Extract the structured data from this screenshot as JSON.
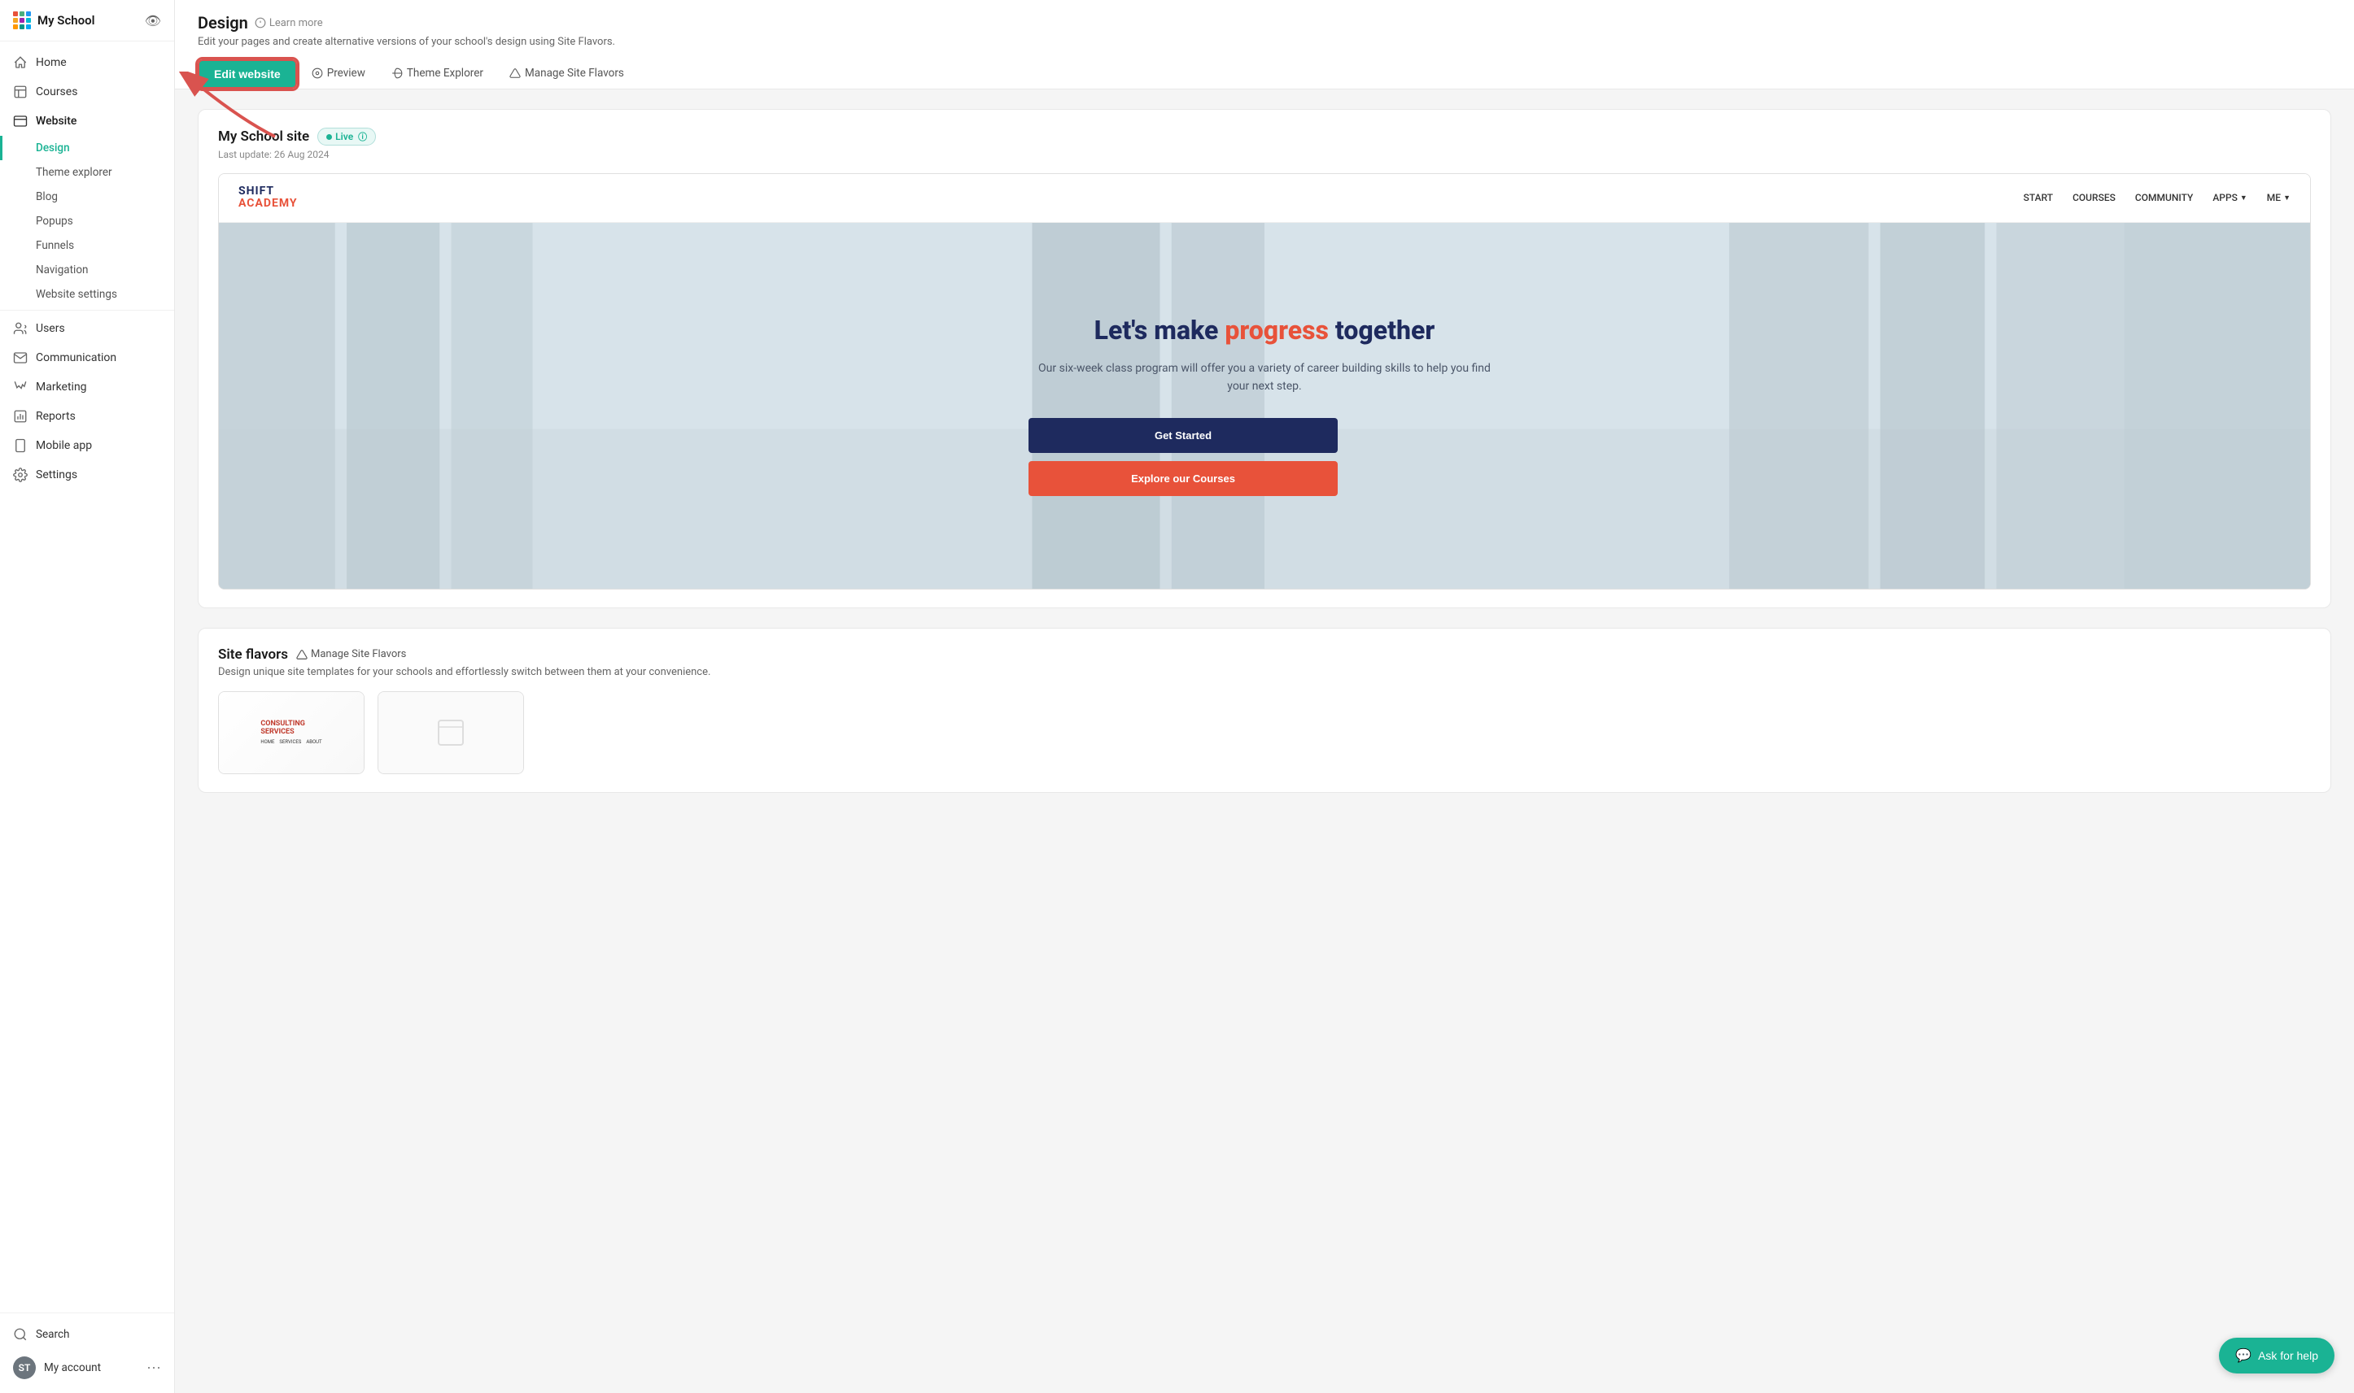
{
  "sidebar": {
    "school_name": "My School",
    "nav_items": [
      {
        "label": "Home",
        "icon": "home",
        "active": false
      },
      {
        "label": "Courses",
        "icon": "courses",
        "active": false
      },
      {
        "label": "Website",
        "icon": "website",
        "active": false,
        "expanded": true
      }
    ],
    "website_subitems": [
      {
        "label": "Design",
        "active": true
      },
      {
        "label": "Theme explorer",
        "active": false
      },
      {
        "label": "Blog",
        "active": false
      },
      {
        "label": "Popups",
        "active": false
      },
      {
        "label": "Funnels",
        "active": false
      },
      {
        "label": "Navigation",
        "active": false
      },
      {
        "label": "Website settings",
        "active": false
      }
    ],
    "other_nav": [
      {
        "label": "Users",
        "icon": "users"
      },
      {
        "label": "Communication",
        "icon": "communication"
      },
      {
        "label": "Marketing",
        "icon": "marketing"
      },
      {
        "label": "Reports",
        "icon": "reports"
      },
      {
        "label": "Mobile app",
        "icon": "mobile"
      },
      {
        "label": "Settings",
        "icon": "settings"
      }
    ],
    "bottom_items": [
      {
        "label": "Search",
        "icon": "search"
      },
      {
        "label": "My account",
        "icon": "avatar",
        "initials": "ST"
      }
    ]
  },
  "header": {
    "title": "Design",
    "learn_more": "Learn more",
    "subtitle": "Edit your pages and create alternative versions of your school's design using Site Flavors.",
    "toolbar": {
      "edit_btn": "Edit website",
      "preview_tab": "Preview",
      "theme_explorer_tab": "Theme Explorer",
      "manage_flavors_tab": "Manage Site Flavors"
    }
  },
  "main": {
    "site_name": "My School site",
    "live_label": "Live",
    "last_update": "Last update: 26 Aug 2024",
    "hero": {
      "headline_part1": "Let's make ",
      "headline_accent": "progress",
      "headline_part2": " together",
      "subtext": "Our six-week class program will offer you a variety of career building skills to help you find your next step.",
      "btn_started": "Get Started",
      "btn_explore": "Explore our Courses"
    },
    "navbar": {
      "logo_line1": "SHIFT",
      "logo_line2": "ACADEMY",
      "links": [
        "START",
        "COURSES",
        "COMMUNITY",
        "APPS",
        "ME"
      ]
    },
    "site_flavors": {
      "title": "Site flavors",
      "manage_label": "Manage Site Flavors",
      "description": "Design unique site templates for your schools and effortlessly switch between them at your convenience."
    }
  },
  "ask_help": {
    "label": "Ask for help"
  }
}
